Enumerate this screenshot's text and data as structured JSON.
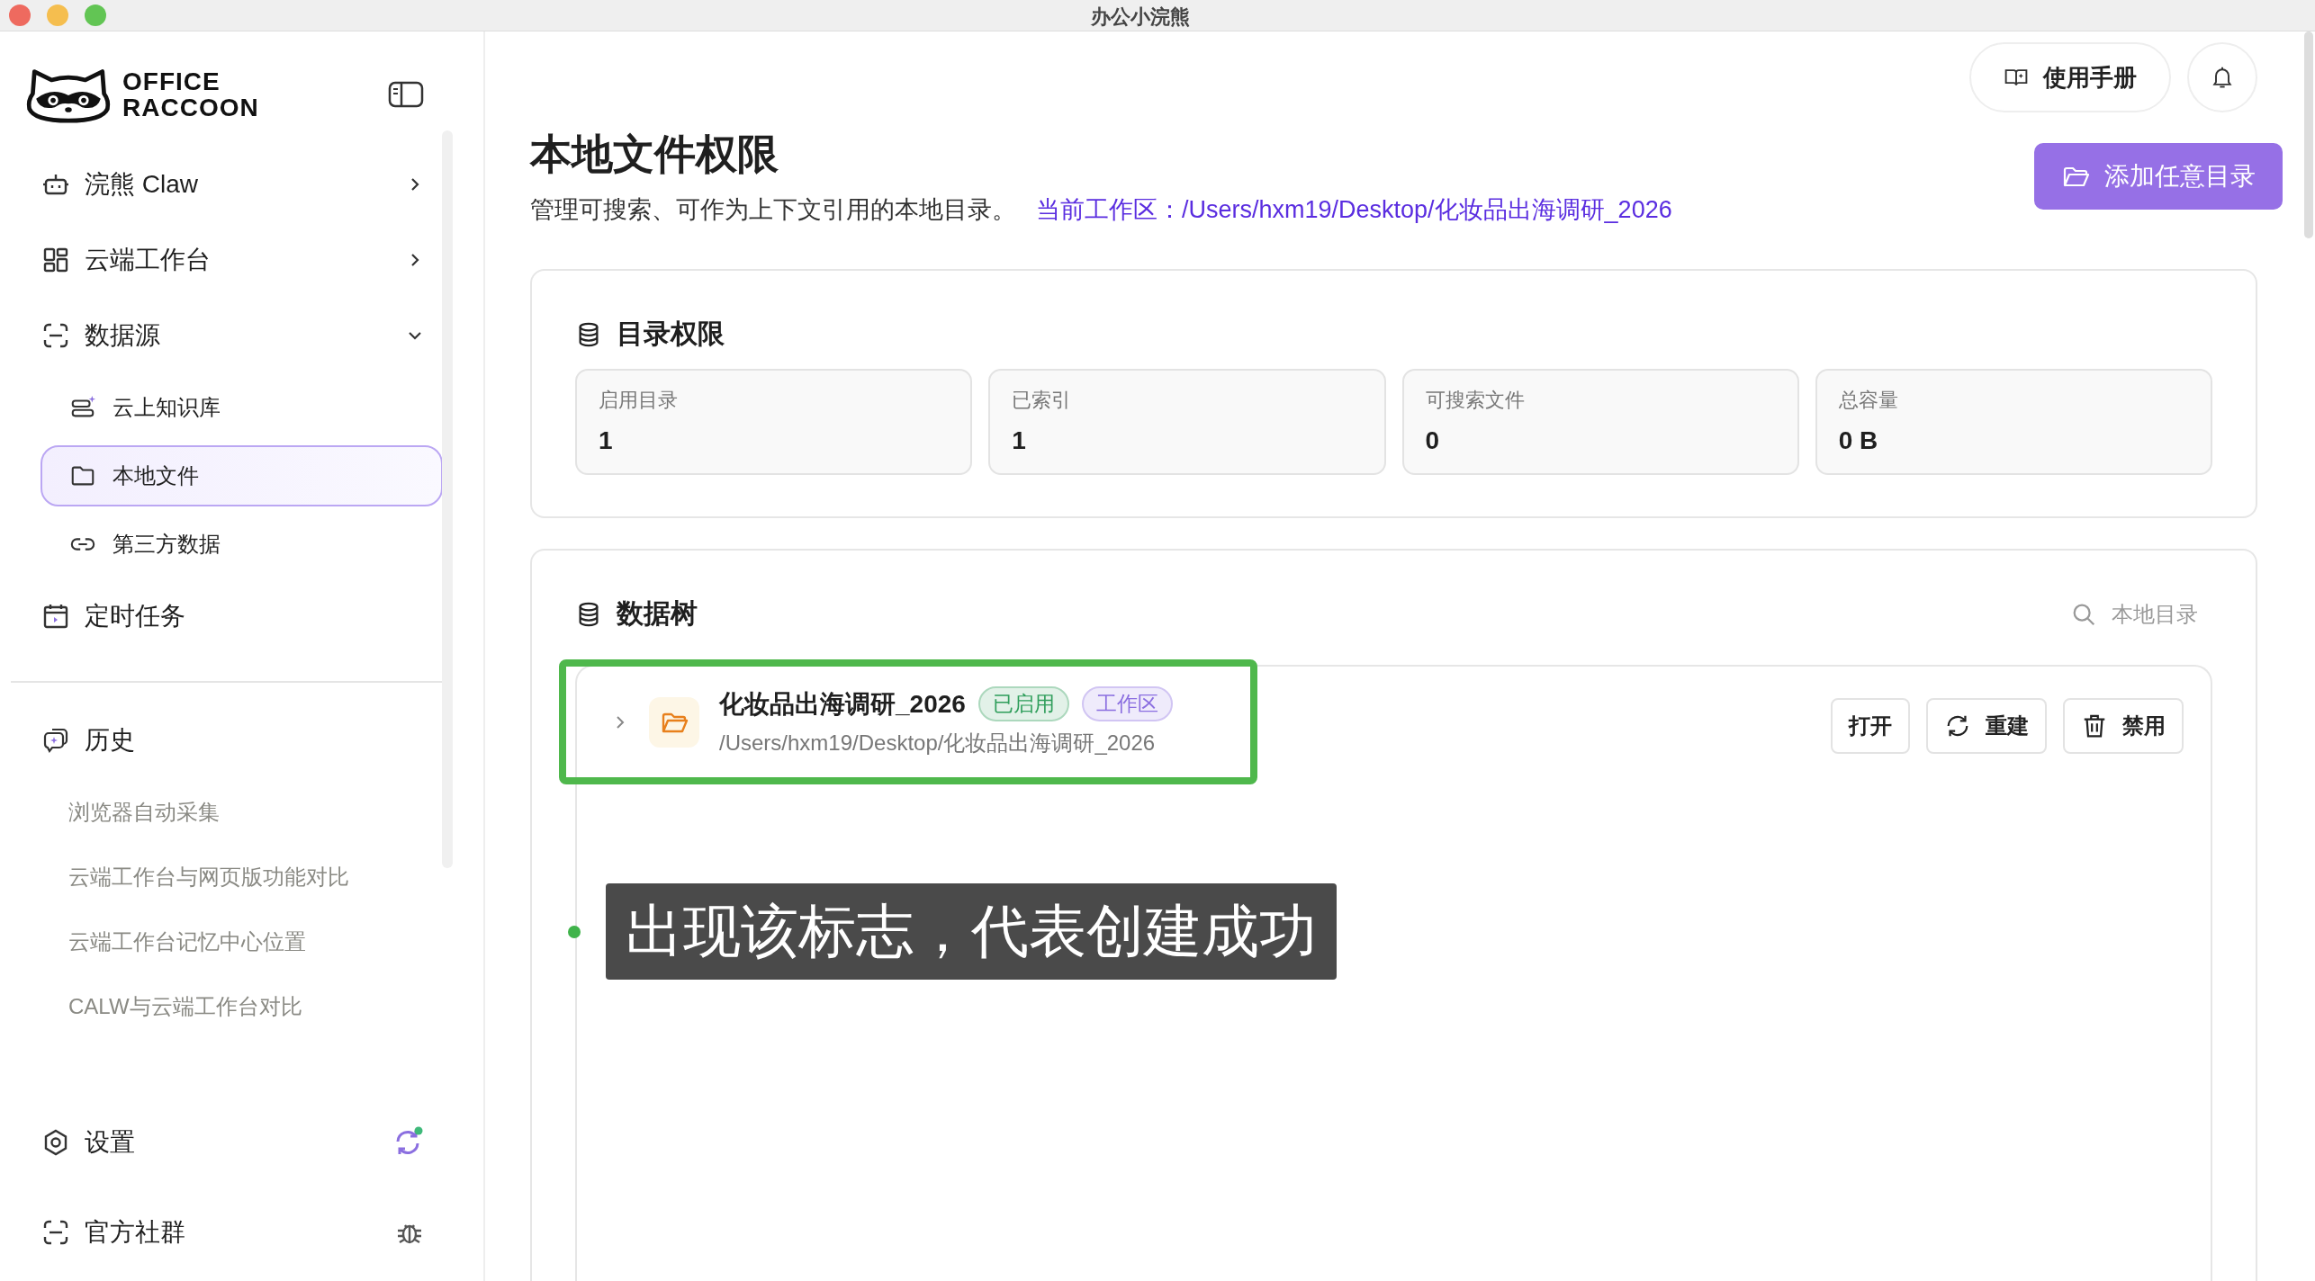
{
  "window": {
    "title": "办公小浣熊"
  },
  "sidebar": {
    "logo_lines": [
      "OFFICE",
      "RACCOON"
    ],
    "nav": [
      {
        "kind": "robot",
        "label": "浣熊 Claw",
        "expanded": false
      },
      {
        "kind": "grid",
        "label": "云端工作台",
        "expanded": false
      },
      {
        "kind": "source",
        "label": "数据源",
        "expanded": true,
        "children": [
          {
            "kind": "knowledge",
            "label": "云上知识库",
            "selected": false
          },
          {
            "kind": "folder",
            "label": "本地文件",
            "selected": true
          },
          {
            "kind": "link",
            "label": "第三方数据",
            "selected": false
          }
        ]
      },
      {
        "kind": "calendar",
        "label": "定时任务"
      }
    ],
    "history_title": "历史",
    "history": [
      "浏览器自动采集",
      "云端工作台与网页版功能对比",
      "云端工作台记忆中心位置",
      "CALW与云端工作台对比"
    ],
    "footer": [
      {
        "kind": "settings",
        "label": "设置"
      },
      {
        "kind": "community",
        "label": "官方社群"
      }
    ]
  },
  "header": {
    "manual_button": "使用手册",
    "title": "本地文件权限",
    "description": "管理可搜索、可作为上下文引用的本地目录。",
    "workspace": "当前工作区：/Users/hxm19/Desktop/化妆品出海调研_2026",
    "add_button": "添加任意目录"
  },
  "permissions": {
    "title": "目录权限",
    "stats": [
      {
        "label": "启用目录",
        "value": "1"
      },
      {
        "label": "已索引",
        "value": "1"
      },
      {
        "label": "可搜索文件",
        "value": "0"
      },
      {
        "label": "总容量",
        "value": "0 B"
      }
    ]
  },
  "tree": {
    "title": "数据树",
    "search": {
      "placeholder": "本地目录"
    },
    "items": [
      {
        "name": "化妆品出海调研_2026",
        "path": "/Users/hxm19/Desktop/化妆品出海调研_2026",
        "expanded": false,
        "tags": [
          {
            "label": "已启用",
            "color": "#2f9e5b"
          },
          {
            "label": "工作区",
            "color": "#8b6fe0"
          }
        ],
        "actions": [
          {
            "kind": "open",
            "label": "打开"
          },
          {
            "kind": "rebuild",
            "label": "重建"
          },
          {
            "kind": "disable",
            "label": "禁用"
          }
        ]
      }
    ]
  },
  "annotation": {
    "text": "出现该标志，代表创建成功"
  }
}
